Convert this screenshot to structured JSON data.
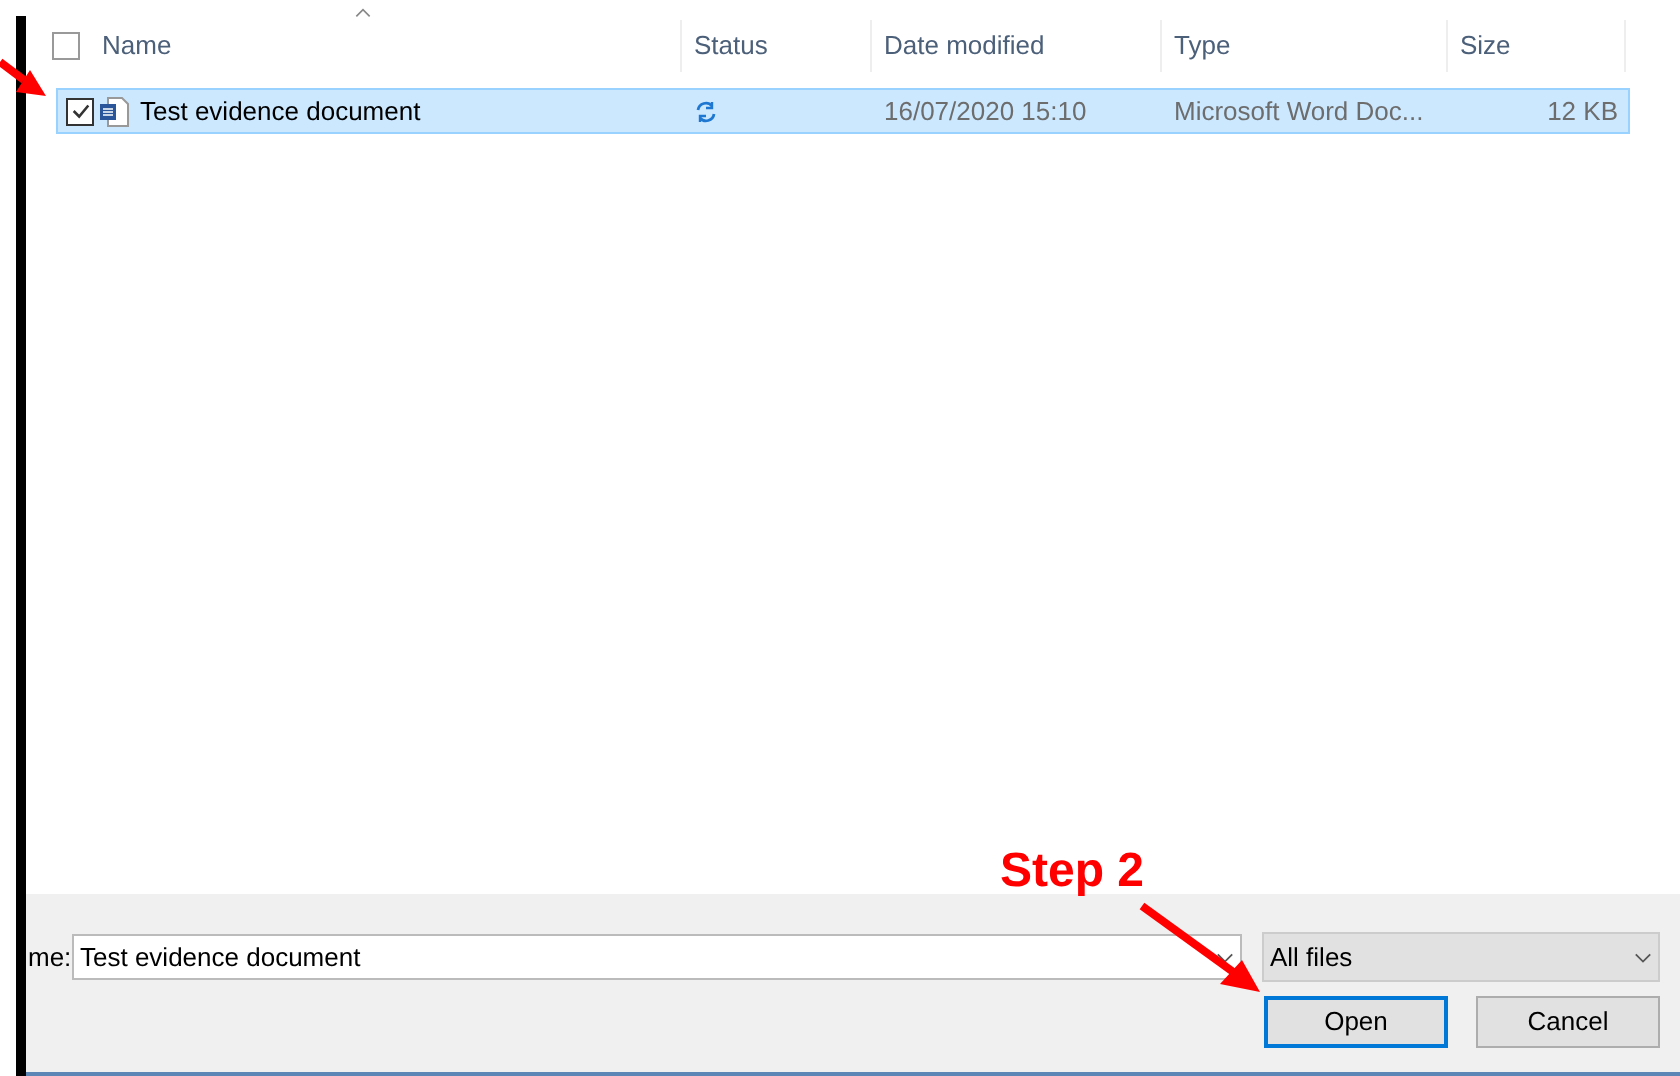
{
  "file_list": {
    "columns": [
      {
        "label": "Name",
        "sorted": true
      },
      {
        "label": "Status",
        "sorted": false
      },
      {
        "label": "Date modified",
        "sorted": false
      },
      {
        "label": "Type",
        "sorted": false
      },
      {
        "label": "Size",
        "sorted": false
      }
    ],
    "select_all_checked": false,
    "rows": [
      {
        "name": "Test evidence document",
        "checked": true,
        "selected": true,
        "syncing": true,
        "date_modified": "16/07/2020 15:10",
        "type": "Microsoft Word Doc...",
        "size": "12 KB"
      }
    ]
  },
  "footer": {
    "file_name_label": "me:",
    "file_name": "Test evidence document",
    "file_type": "All files",
    "buttons": [
      {
        "label": "Open",
        "default": true
      },
      {
        "label": "Cancel",
        "default": false
      }
    ]
  },
  "annotation": {
    "label": "Step 2"
  }
}
